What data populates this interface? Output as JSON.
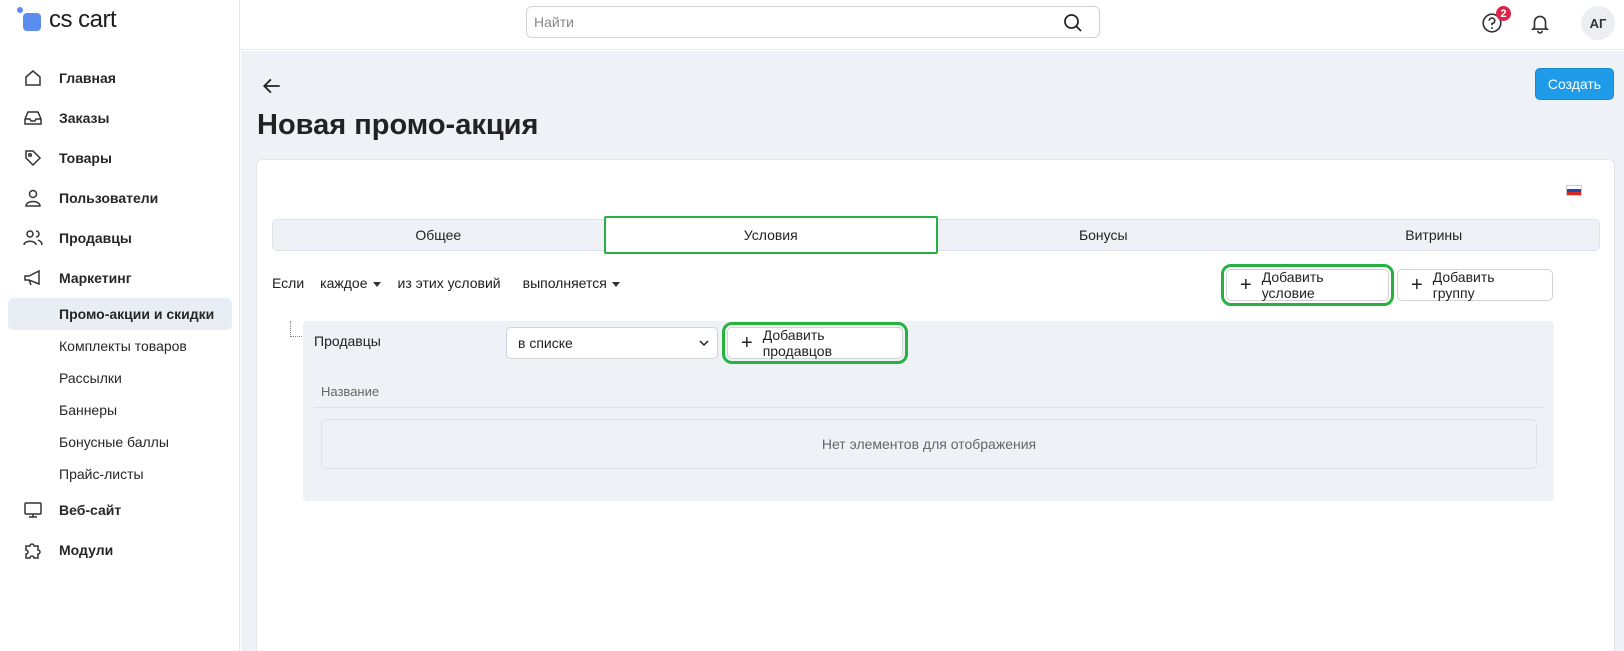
{
  "brand": {
    "name": "cs cart",
    "accent": "#5b8def"
  },
  "search": {
    "placeholder": "Найти"
  },
  "header": {
    "notifications_badge": "2",
    "avatar_initials": "АГ"
  },
  "sidebar": {
    "items": [
      {
        "label": "Главная",
        "icon": "home-icon"
      },
      {
        "label": "Заказы",
        "icon": "inbox-icon"
      },
      {
        "label": "Товары",
        "icon": "tag-icon"
      },
      {
        "label": "Пользователи",
        "icon": "user-icon"
      },
      {
        "label": "Продавцы",
        "icon": "users-icon"
      },
      {
        "label": "Маркетинг",
        "icon": "megaphone-icon"
      }
    ],
    "marketing_sub": [
      {
        "label": "Промо-акции и скидки",
        "active": true
      },
      {
        "label": "Комплекты товаров"
      },
      {
        "label": "Рассылки"
      },
      {
        "label": "Баннеры"
      },
      {
        "label": "Бонусные баллы"
      },
      {
        "label": "Прайс-листы"
      }
    ],
    "bottom_items": [
      {
        "label": "Веб-сайт",
        "icon": "monitor-icon"
      },
      {
        "label": "Модули",
        "icon": "puzzle-icon"
      }
    ]
  },
  "page": {
    "title": "Новая промо-акция",
    "create_label": "Создать",
    "create_color": "#1e9be9"
  },
  "tabs": [
    {
      "label": "Общее"
    },
    {
      "label": "Условия",
      "active": true
    },
    {
      "label": "Бонусы"
    },
    {
      "label": "Витрины"
    }
  ],
  "conditions": {
    "if_label": "Если",
    "mode_value": "каждое",
    "of_these_label": "из этих условий",
    "state_value": "выполняется",
    "add_condition_label": "Добавить условие",
    "add_group_label": "Добавить группу"
  },
  "group": {
    "label": "Продавцы",
    "operator_value": "в списке",
    "add_vendors_label": "Добавить продавцов",
    "column_name": "Название",
    "empty_text": "Нет элементов для отображения"
  },
  "highlight_color": "#27b140"
}
